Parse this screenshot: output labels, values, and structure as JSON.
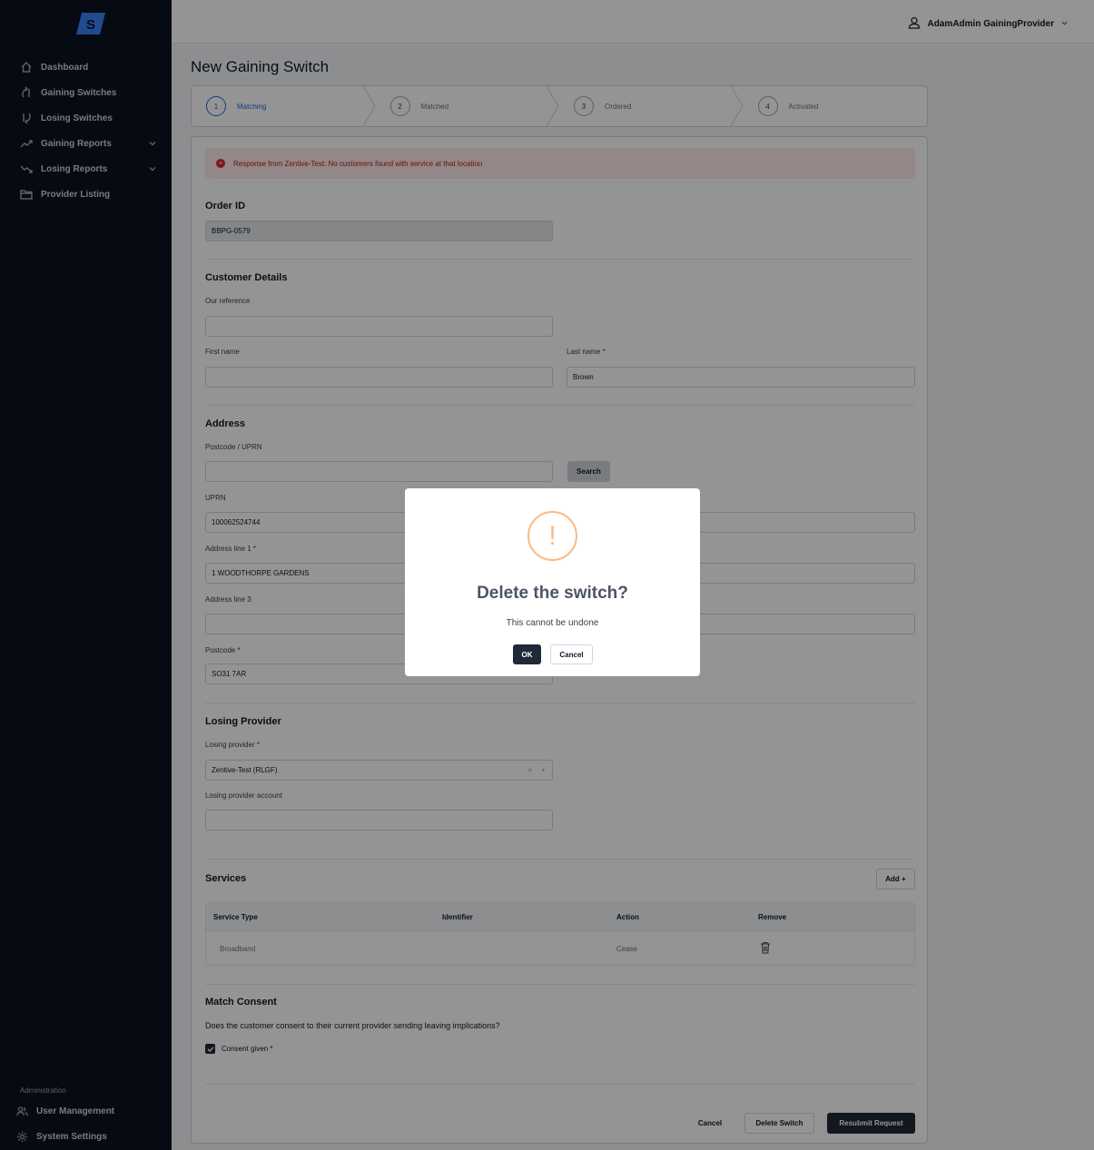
{
  "app": {
    "logo_letter": "S",
    "accent": "#2563eb",
    "sidebar_bg": "#0b1220"
  },
  "sidebar": {
    "items": [
      {
        "label": "Dashboard",
        "icon": "home-icon"
      },
      {
        "label": "Gaining Switches",
        "icon": "arrow-up-curve-icon"
      },
      {
        "label": "Losing Switches",
        "icon": "arrow-down-curve-icon"
      },
      {
        "label": "Gaining Reports",
        "icon": "trending-up-icon"
      },
      {
        "label": "Losing Reports",
        "icon": "trending-down-icon"
      },
      {
        "label": "Provider Listing",
        "icon": "folder-icon"
      }
    ],
    "admin_label": "Administration",
    "admin_items": [
      {
        "label": "User Management",
        "icon": "users-icon"
      },
      {
        "label": "System Settings",
        "icon": "gear-icon"
      }
    ]
  },
  "header": {
    "user_name": "AdamAdmin GainingProvider"
  },
  "page": {
    "title": "New Gaining Switch"
  },
  "stepper": [
    {
      "num": "1",
      "label": "Matching"
    },
    {
      "num": "2",
      "label": "Matched"
    },
    {
      "num": "3",
      "label": "Ordered"
    },
    {
      "num": "4",
      "label": "Activated"
    }
  ],
  "alert": {
    "message": "Response from Zentive-Test: No customers found with service at that location"
  },
  "order": {
    "section": "Order ID",
    "value": "BBPG-0579"
  },
  "customer": {
    "section": "Customer Details",
    "our_reference_label": "Our reference",
    "our_reference_value": "",
    "first_name_label": "First name",
    "first_name_value": "",
    "last_name_label": "Last name *",
    "last_name_value": "Brown"
  },
  "address": {
    "section": "Address",
    "postcode_uprn_label": "Postcode / UPRN",
    "search_label": "Search",
    "uprn_label": "UPRN",
    "uprn_value": "100062524744",
    "line1_label": "Address line 1 *",
    "line1_value": "1 WOODTHORPE GARDENS",
    "line3_label": "Address line 3",
    "line3_value": "",
    "postcode_label": "Postcode *",
    "postcode_value": "SO31 7AR"
  },
  "losing": {
    "section": "Losing Provider",
    "provider_label": "Losing provider *",
    "provider_value": "Zentive-Test (RLGF)",
    "clear_glyph": "×",
    "account_label": "Losing provider account",
    "account_value": ""
  },
  "services": {
    "section": "Services",
    "add_label": "Add +",
    "columns": [
      "Service Type",
      "Identifier",
      "Action",
      "Remove"
    ],
    "rows": [
      {
        "service_type": "Broadband",
        "identifier": "",
        "action": "Cease"
      }
    ]
  },
  "consent": {
    "section": "Match Consent",
    "question": "Does the customer consent to their current provider sending leaving implications?",
    "checkbox_label": "Consent given *",
    "checked": true
  },
  "footer": {
    "cancel_label": "Cancel",
    "delete_label": "Delete Switch",
    "resubmit_label": "Resubmit Request"
  },
  "modal": {
    "icon_glyph": "!",
    "title": "Delete the switch?",
    "text": "This cannot be undone",
    "ok_label": "OK",
    "cancel_label": "Cancel",
    "warn_color": "#f8bb86"
  }
}
